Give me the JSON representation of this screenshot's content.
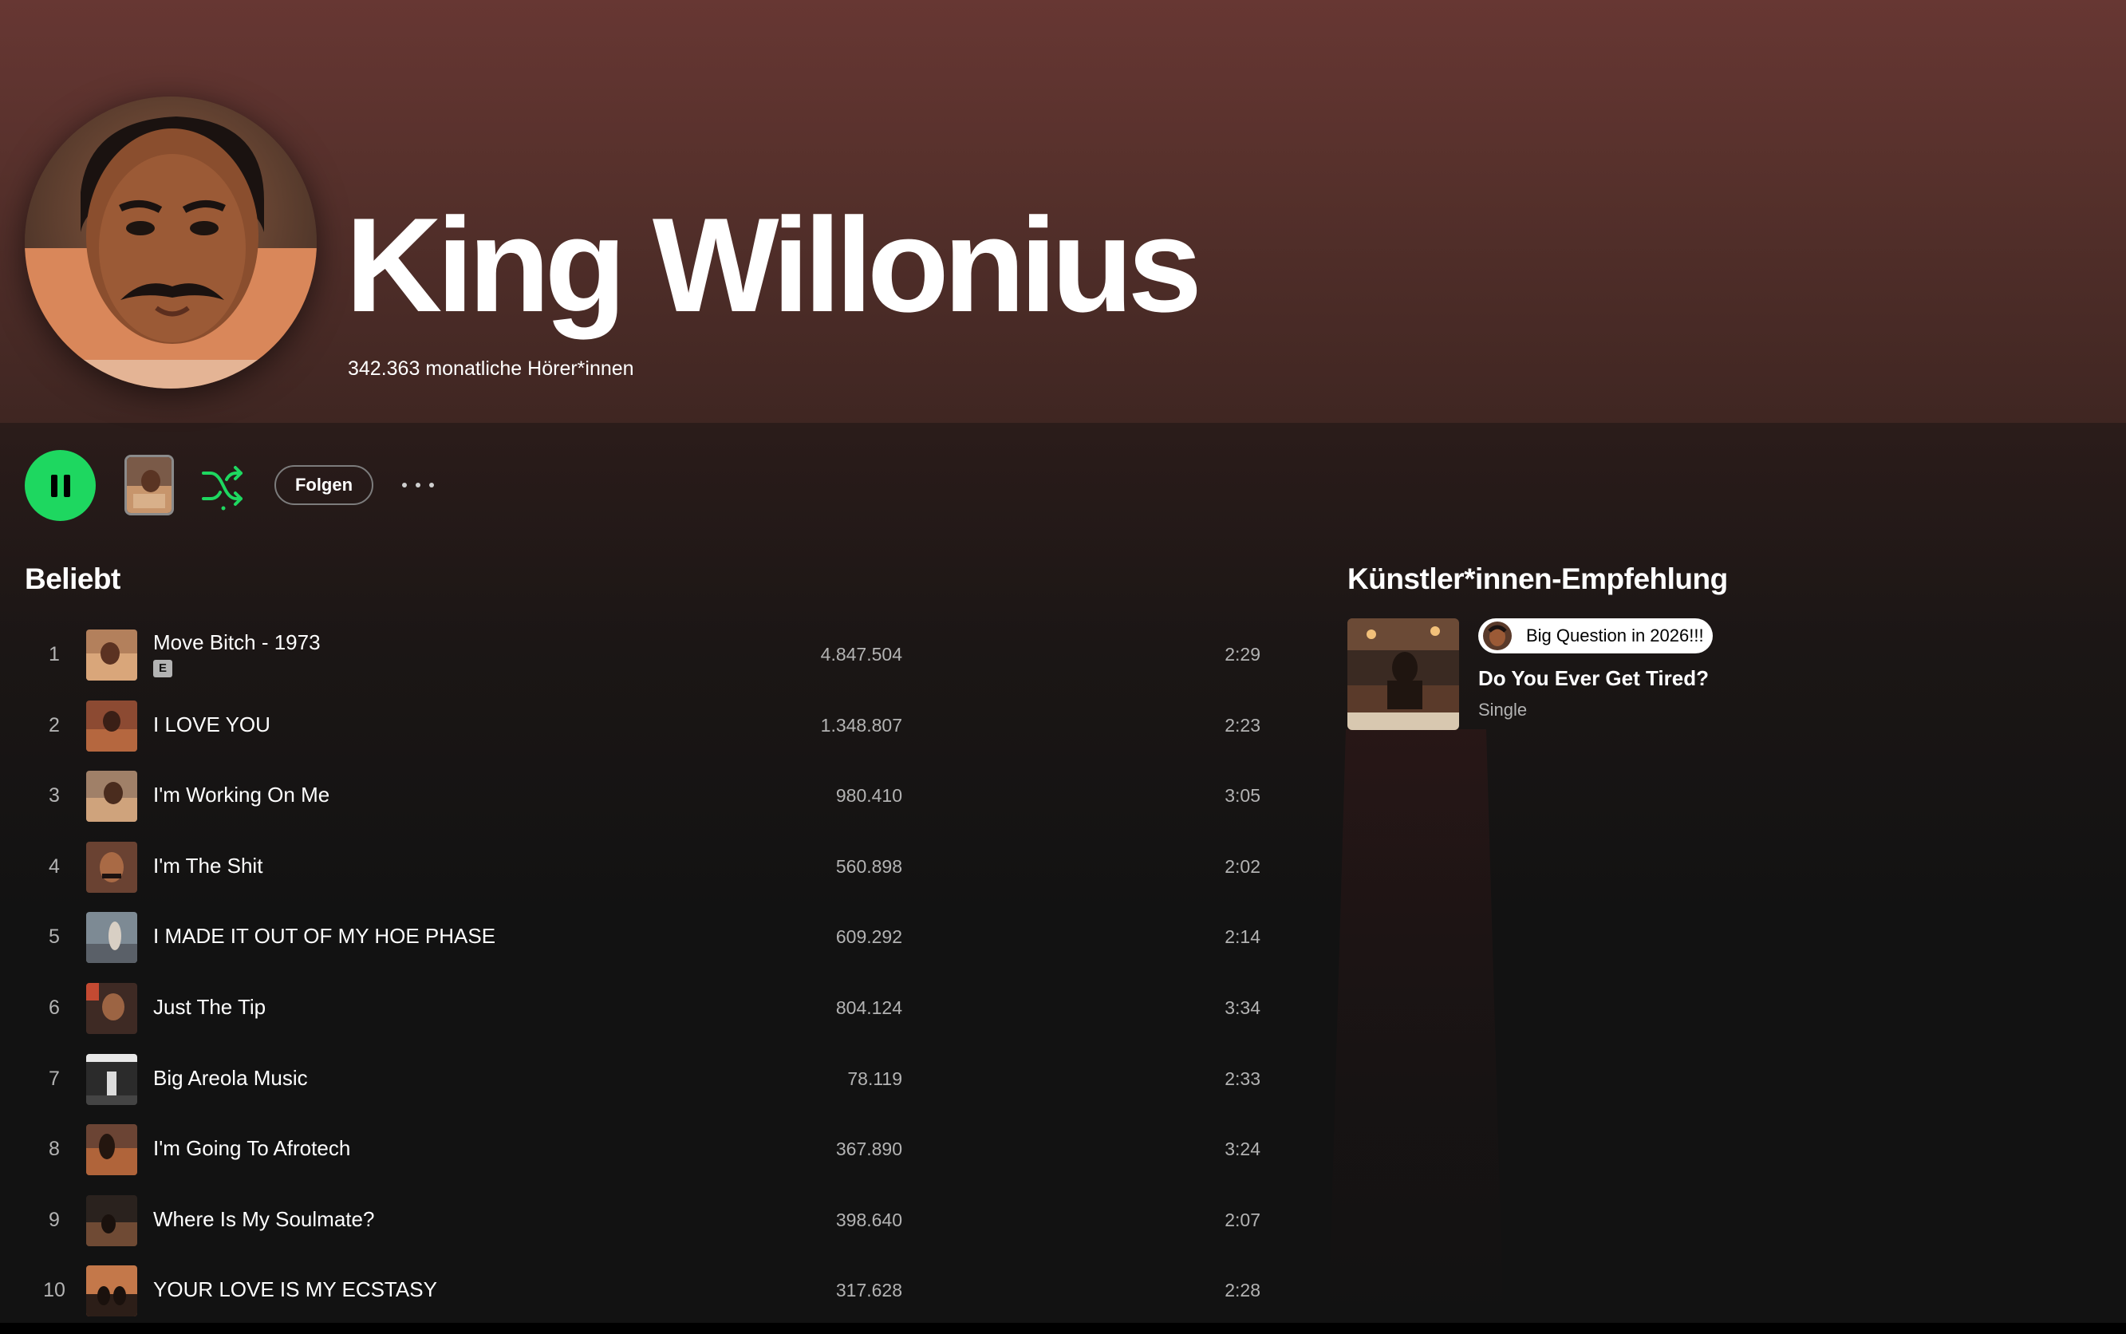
{
  "artist": {
    "name": "King Willonius",
    "monthly_listeners": "342.363 monatliche Hörer*innen"
  },
  "controls": {
    "follow_label": "Folgen"
  },
  "popular": {
    "heading": "Beliebt",
    "tracks": [
      {
        "rank": "1",
        "title": "Move Bitch - 1973",
        "explicit": "E",
        "plays": "4.847.504",
        "duration": "2:29"
      },
      {
        "rank": "2",
        "title": "I LOVE YOU",
        "plays": "1.348.807",
        "duration": "2:23"
      },
      {
        "rank": "3",
        "title": "I'm Working On Me",
        "plays": "980.410",
        "duration": "3:05"
      },
      {
        "rank": "4",
        "title": "I'm The Shit",
        "plays": "560.898",
        "duration": "2:02"
      },
      {
        "rank": "5",
        "title": "I MADE IT OUT OF MY HOE PHASE",
        "plays": "609.292",
        "duration": "2:14"
      },
      {
        "rank": "6",
        "title": "Just The Tip",
        "plays": "804.124",
        "duration": "3:34"
      },
      {
        "rank": "7",
        "title": "Big Areola Music",
        "plays": "78.119",
        "duration": "2:33"
      },
      {
        "rank": "8",
        "title": "I'm Going To Afrotech",
        "plays": "367.890",
        "duration": "3:24"
      },
      {
        "rank": "9",
        "title": "Where Is My Soulmate?",
        "plays": "398.640",
        "duration": "2:07"
      },
      {
        "rank": "10",
        "title": "YOUR LOVE IS MY ECSTASY",
        "plays": "317.628",
        "duration": "2:28"
      }
    ]
  },
  "recommendation": {
    "heading": "Künstler*innen-Empfehlung",
    "pill_text": "Big Question in 2026!!!",
    "title": "Do You Ever Get Tired?",
    "subtitle": "Single"
  },
  "colors": {
    "accent": "#1ed760",
    "background": "#121212",
    "hero_top": "#673733",
    "secondary_text": "#b3b3b3"
  },
  "icons": [
    "pause-icon",
    "shuffle-icon",
    "more-options-icon",
    "explicit-badge"
  ]
}
